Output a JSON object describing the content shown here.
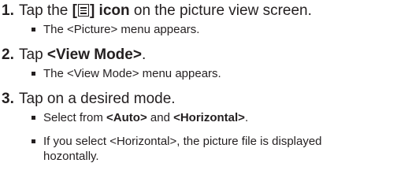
{
  "steps": [
    {
      "number": "1.",
      "text_before": "Tap the ",
      "bold_open": "[",
      "icon": "menu-list-icon",
      "bold_close": "] icon",
      "text_after": " on the picture view screen.",
      "bullets": [
        {
          "text": "The <Picture> menu appears."
        }
      ]
    },
    {
      "number": "2.",
      "text_before": "Tap ",
      "bold": "<View Mode>",
      "text_after": ".",
      "bullets": [
        {
          "text": "The <View Mode> menu appears."
        }
      ]
    },
    {
      "number": "3.",
      "text": "Tap on a desired mode.",
      "bullets": [
        {
          "text_before": "Select from ",
          "bold_a": "<Auto>",
          "mid": " and ",
          "bold_b": "<Horizontal>",
          "text_after": "."
        },
        {
          "line1": "If you select <Horizontal>, the picture file is displayed",
          "line2": "hozontally."
        }
      ]
    }
  ]
}
